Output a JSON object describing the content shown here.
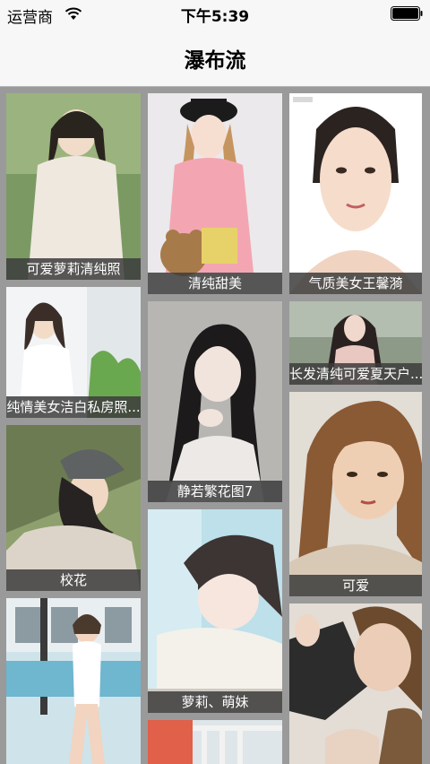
{
  "statusbar": {
    "carrier": "运营商",
    "time": "下午5:39",
    "icons": [
      "wifi-icon",
      "battery-icon"
    ]
  },
  "navbar": {
    "title": "瀑布流"
  },
  "cards": [
    {
      "caption": "可爱萝莉清纯照",
      "palette": [
        "#5f8a4e",
        "#e8e0d8",
        "#2a241f"
      ]
    },
    {
      "caption": "纯情美女洁白私房照...",
      "palette": [
        "#e9ecef",
        "#ffffff",
        "#3b2e28"
      ]
    },
    {
      "caption": "校花",
      "palette": [
        "#8b9a6a",
        "#dcd4c9",
        "#262322"
      ]
    },
    {
      "caption": "",
      "palette": [
        "#6fb6cf",
        "#ffffff",
        "#4a3a2e"
      ]
    },
    {
      "caption": "清纯甜美",
      "palette": [
        "#e6e4e6",
        "#f3a6b2",
        "#1b1b1b"
      ]
    },
    {
      "caption": "静若繁花图7",
      "palette": [
        "#8a8a8a",
        "#bfbdb8",
        "#1c1a1b"
      ]
    },
    {
      "caption": "萝莉、萌妹",
      "palette": [
        "#b7dbe6",
        "#f1efe6",
        "#3c3533"
      ]
    },
    {
      "caption": "",
      "palette": [
        "#e0604a",
        "#f2f2f2",
        "#2e2e2e"
      ]
    },
    {
      "caption": "气质美女王馨漪",
      "palette": [
        "#ffffff",
        "#f6dccb",
        "#2b2320"
      ]
    },
    {
      "caption": "长发清纯可爱夏天户...",
      "palette": [
        "#6d7a66",
        "#e8c8c0",
        "#2a2220"
      ]
    },
    {
      "caption": "可爱",
      "palette": [
        "#d8d2c8",
        "#efcfb4",
        "#6b4a2e"
      ]
    },
    {
      "caption": "",
      "palette": [
        "#4b4b4b",
        "#e8d2c2",
        "#7a5a3a"
      ]
    }
  ]
}
